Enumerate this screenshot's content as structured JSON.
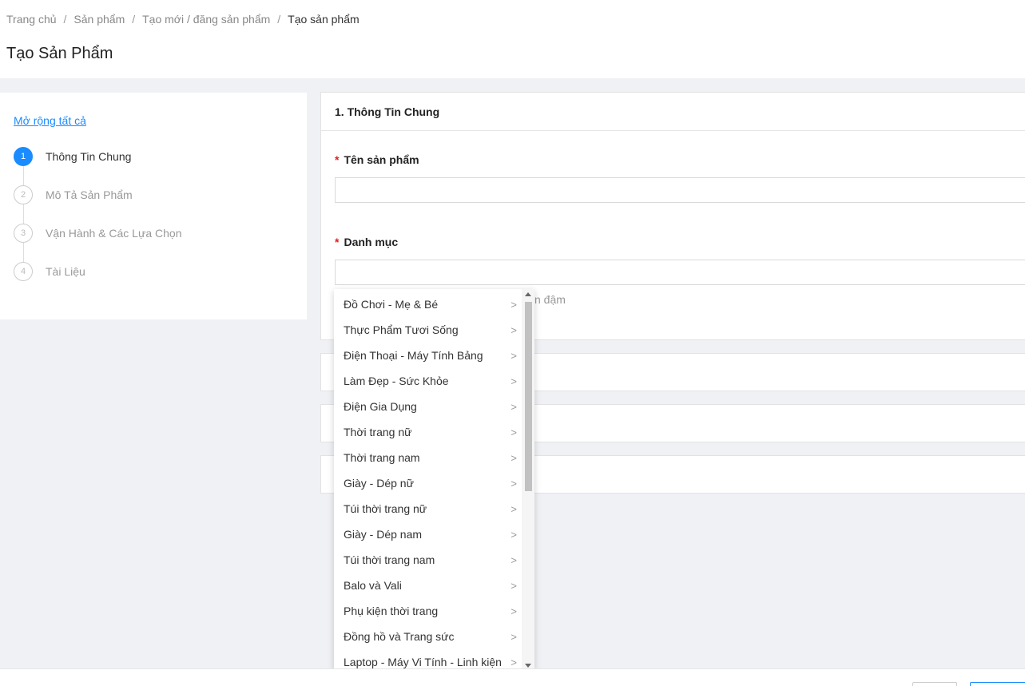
{
  "breadcrumb": {
    "items": [
      "Trang chủ",
      "Sản phẩm",
      "Tạo mới / đăng sản phẩm",
      "Tạo sản phẩm"
    ],
    "separator": "/"
  },
  "page_title": "Tạo Sản Phẩm",
  "stepper": {
    "expand_all": "Mở rộng tất cả",
    "steps": [
      {
        "num": "1",
        "label": "Thông Tin Chung",
        "active": true
      },
      {
        "num": "2",
        "label": "Mô Tả Sản Phẩm",
        "active": false
      },
      {
        "num": "3",
        "label": "Vận Hành & Các Lựa Chọn",
        "active": false
      },
      {
        "num": "4",
        "label": "Tài Liệu",
        "active": false
      }
    ]
  },
  "section_general": {
    "title": "1. Thông Tin Chung",
    "required_mark": "*",
    "product_name_label": "Tên sản phẩm",
    "product_name_value": "",
    "category_label": "Danh mục",
    "category_value": "",
    "hint_fragment": "n đậm"
  },
  "category_dropdown": {
    "chevron": ">",
    "items": [
      "Đồ Chơi - Mẹ & Bé",
      "Thực Phẩm Tươi Sống",
      "Điện Thoại - Máy Tính Bảng",
      "Làm Đẹp - Sức Khỏe",
      "Điện Gia Dụng",
      "Thời trang nữ",
      "Thời trang nam",
      "Giày - Dép nữ",
      "Túi thời trang nữ",
      "Giày - Dép nam",
      "Túi thời trang nam",
      "Balo và Vali",
      "Phụ kiện thời trang",
      "Đồng hồ và Trang sức",
      "Laptop - Máy Vi Tính - Linh kiện"
    ]
  },
  "colors": {
    "accent": "#1a8cff",
    "required": "#e02020",
    "background": "#f0f1f5"
  }
}
